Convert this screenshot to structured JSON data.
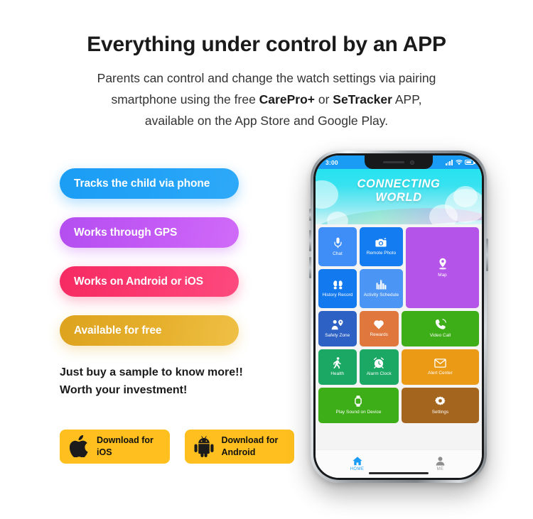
{
  "header": {
    "headline": "Everything under control by an APP",
    "sub_line1_a": "Parents can control and change the watch settings via pairing",
    "sub_line2_a": "smartphone using the free ",
    "sub_line2_b": "CarePro+",
    "sub_line2_c": " or ",
    "sub_line2_d": "SeTracker",
    "sub_line2_e": " APP,",
    "sub_line3": "available on the App Store and Google Play."
  },
  "features": {
    "pills": [
      {
        "label": "Tracks the child via phone",
        "color": "#21a0f5"
      },
      {
        "label": "Works through GPS",
        "color": "#c45bf6"
      },
      {
        "label": "Works on Android or iOS",
        "color": "#fb3a70"
      },
      {
        "label": "Available for free",
        "color": "#e4af28"
      }
    ]
  },
  "cta": {
    "tagline_line1": "Just buy a sample to know more!!",
    "tagline_line2": "Worth your investment!",
    "buttons": [
      {
        "icon": "apple-icon",
        "line1": "Download for",
        "line2": "iOS"
      },
      {
        "icon": "android-icon",
        "line1": "Download for",
        "line2": "Android"
      }
    ],
    "button_color": "#ffc01f"
  },
  "phone": {
    "status": {
      "time": "3:00",
      "signal": "signal-bars-icon",
      "wifi": "wifi-icon",
      "battery": "battery-icon"
    },
    "banner": {
      "line1": "CONNECTING",
      "line2": "WORLD"
    },
    "tiles": [
      {
        "label": "Chat",
        "icon": "microphone-icon",
        "color": "#3f8ef7"
      },
      {
        "label": "Remote Photo",
        "icon": "camera-icon",
        "color": "#127cf0"
      },
      {
        "label": "History Record",
        "icon": "footprints-icon",
        "color": "#1379ef"
      },
      {
        "label": "Activity Schedule",
        "icon": "bar-chart-icon",
        "color": "#4b95f5"
      },
      {
        "label": "Map",
        "icon": "map-pin-icon",
        "color": "#b454e8"
      },
      {
        "label": "Safety Zone",
        "icon": "person-location-icon",
        "color": "#2e61c4"
      },
      {
        "label": "Rewards",
        "icon": "heart-icon",
        "color": "#e0773c"
      },
      {
        "label": "Video Call",
        "icon": "phone-call-icon",
        "color": "#3eae18"
      },
      {
        "label": "Health",
        "icon": "walking-person-icon",
        "color": "#1aa864"
      },
      {
        "label": "Alarm Clock",
        "icon": "alarm-clock-icon",
        "color": "#1aa864"
      },
      {
        "label": "Alert Center",
        "icon": "envelope-icon",
        "color": "#eb9a16"
      },
      {
        "label": "Play Sound on Device",
        "icon": "watch-icon",
        "color": "#3eae18"
      },
      {
        "label": "Settings",
        "icon": "gear-icon",
        "color": "#a4651e"
      }
    ],
    "navbar": [
      {
        "label": "HOME",
        "icon": "home-icon",
        "active": true
      },
      {
        "label": "ME",
        "icon": "person-icon",
        "active": false
      }
    ]
  }
}
